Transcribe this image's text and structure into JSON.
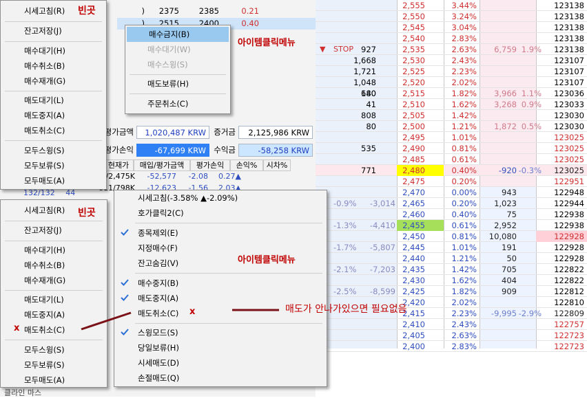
{
  "annotations": {
    "empty_label_1": "빈곳",
    "empty_label_2": "빈곳",
    "item_click_menu_1": "아이템클릭메뉴",
    "item_click_menu_2": "아이템클릭메뉴",
    "note": "매도가 안나가있으면 필요없음",
    "x_mark": "x",
    "x_mark_2": "x"
  },
  "menu_empty_top": {
    "items": [
      "시세고침(R)",
      "잔고저장(J)",
      "매수대기(H)",
      "매수취소(B)",
      "매수재개(G)",
      "매도대기(L)",
      "매도중지(A)",
      "매도취소(C)",
      "모두스윙(S)",
      "모두보류(S)",
      "모두매도(A)"
    ]
  },
  "menu_empty_bottom": {
    "items": [
      "시세고침(R)",
      "잔고저장(J)",
      "매수대기(H)",
      "매수취소(B)",
      "매수재개(G)",
      "매도대기(L)",
      "매도중지(A)",
      "매도취소(C)",
      "모두스윙(S)",
      "모두보류(S)",
      "모두매도(A)"
    ]
  },
  "menu_item_top": {
    "items": [
      "매수금지(B)",
      "매수대기(W)",
      "매수스윙(S)",
      "매도보류(H)",
      "주문취소(C)"
    ]
  },
  "menu_item_bottom": {
    "items": [
      "시세고침(-3.58% ▲-2.09%)",
      "호가클릭2(C)",
      "종목제외(E)",
      "지정매수(F)",
      "잔고숨김(V)",
      "매수중지(B)",
      "매도중지(A)",
      "매도취소(C)",
      "스윙모드(S)",
      "당일보류(H)",
      "시세매도(D)",
      "손절매도(Q)"
    ]
  },
  "summary": {
    "eval_label": "평가금액",
    "eval_value": "1,020,487 KRW",
    "deposit_label": "증거금",
    "deposit_value": "2,125,986 KRW",
    "pl_label": "평가손익",
    "pl_value": "-67,699 KRW",
    "profit_label": "수익금",
    "profit_value": "-58,258 KRW"
  },
  "holdings_header": [
    "현재가",
    "매입/평가금액",
    "평가손익",
    "손익%",
    "시차%"
  ],
  "holdings_rows": [
    [
      "2,527/2,475K",
      "-52,577",
      "-2.08",
      "0.27▲"
    ],
    [
      "811/798K",
      "-12,623",
      "-1.56",
      "2.03▲"
    ]
  ],
  "holdings_side": [
    "132/132",
    "44"
  ],
  "small_table": [
    [
      "2375",
      "2385",
      "0.21"
    ],
    [
      "2515",
      "2400",
      "0.40"
    ]
  ],
  "pct_partial": "%)",
  "bottom_left_text": "클라인 마스",
  "book": {
    "stop_label": "STOP",
    "rows": [
      {
        "price": "2,555",
        "rate": "3.44%",
        "time": "123138"
      },
      {
        "price": "2,550",
        "rate": "3.24%",
        "time": "123138"
      },
      {
        "price": "2,545",
        "rate": "3.04%",
        "time": "123138"
      },
      {
        "price": "2,540",
        "rate": "2.83%",
        "time": "123138"
      },
      {
        "qty": "927",
        "price": "2,535",
        "rate": "2.63%",
        "amt": "6,759",
        "pct": "1.9%",
        "time": "123138"
      },
      {
        "qty": "1,668",
        "price": "2,530",
        "rate": "2.43%",
        "time": "123107"
      },
      {
        "qty": "1,721",
        "price": "2,525",
        "rate": "2.23%",
        "time": "123107"
      },
      {
        "qty": "1,048",
        "price": "2,520",
        "rate": "2.02%",
        "time": "123107"
      },
      {
        "ask": "140",
        "qty": "680",
        "price": "2,515",
        "rate": "1.82%",
        "amt": "3,966",
        "pct": "1.1%",
        "time": "123036"
      },
      {
        "qty": "41",
        "price": "2,510",
        "rate": "1.62%",
        "amt": "3,268",
        "pct": "0.9%",
        "time": "123033"
      },
      {
        "qty": "808",
        "price": "2,505",
        "rate": "1.42%",
        "time": "123030"
      },
      {
        "qty": "80",
        "price": "2,500",
        "rate": "1.21%",
        "amt": "1,872",
        "pct": "0.5%",
        "time": "123030"
      },
      {
        "price": "2,495",
        "rate": "1.01%",
        "time": "123025"
      },
      {
        "qty": "535",
        "price": "2,490",
        "rate": "0.81%",
        "time": "123025"
      },
      {
        "price": "2,485",
        "rate": "0.61%",
        "time": "123025"
      },
      {
        "qty": "771",
        "price": "2,480",
        "rate": "0.40%",
        "amt": "-920",
        "pct": "-0.3%",
        "time": "123025"
      },
      {
        "price": "2,475",
        "rate": "0.20%",
        "time": "122951"
      },
      {
        "price": "2,470",
        "rate": "0.00%",
        "amt": "943",
        "time": "122948"
      },
      {
        "chg2": "-0.9%",
        "chg3": "-3,014",
        "price": "2,465",
        "rate": "0.20%",
        "amt": "1,023",
        "time": "122944"
      },
      {
        "price": "2,460",
        "rate": "0.40%",
        "amt": "75",
        "time": "122938"
      },
      {
        "chg2": "-1.3%",
        "chg3": "-4,410",
        "price": "2,455",
        "rate": "0.61%",
        "amt": "2,952",
        "time": "122938"
      },
      {
        "price": "2,450",
        "rate": "0.81%",
        "amt": "10,080",
        "time": "122928"
      },
      {
        "chg2": "-1.7%",
        "chg3": "-5,807",
        "price": "2,445",
        "rate": "1.01%",
        "amt": "191",
        "time": "122928"
      },
      {
        "price": "2,440",
        "rate": "1.21%",
        "amt": "50",
        "time": "122928"
      },
      {
        "chg2": "-2.1%",
        "chg3": "-7,203",
        "price": "2,435",
        "rate": "1.42%",
        "amt": "705",
        "time": "122822"
      },
      {
        "price": "2,430",
        "rate": "1.62%",
        "amt": "404",
        "time": "122822"
      },
      {
        "chg2": "-2.5%",
        "chg3": "-8,599",
        "price": "2,425",
        "rate": "1.82%",
        "amt": "909",
        "time": "122812"
      },
      {
        "price": "2,420",
        "rate": "2.02%",
        "time": "122810"
      },
      {
        "price": "2,415",
        "rate": "2.23%",
        "amt": "-9,995",
        "pct": "-2.9%",
        "time": "122809"
      },
      {
        "price": "2,410",
        "rate": "2.43%",
        "time": "122757"
      },
      {
        "price": "2,405",
        "rate": "2.63%",
        "time": "122723"
      },
      {
        "price": "2,400",
        "rate": "2.83%",
        "time": "122723"
      }
    ]
  },
  "colors": {
    "ask_red": "#d03030",
    "bid_blue": "#2f4fc0",
    "highlight_yellow": "#ffff00",
    "highlight_green": "#a6e05a",
    "menu_highlight": "#99c9ef"
  }
}
